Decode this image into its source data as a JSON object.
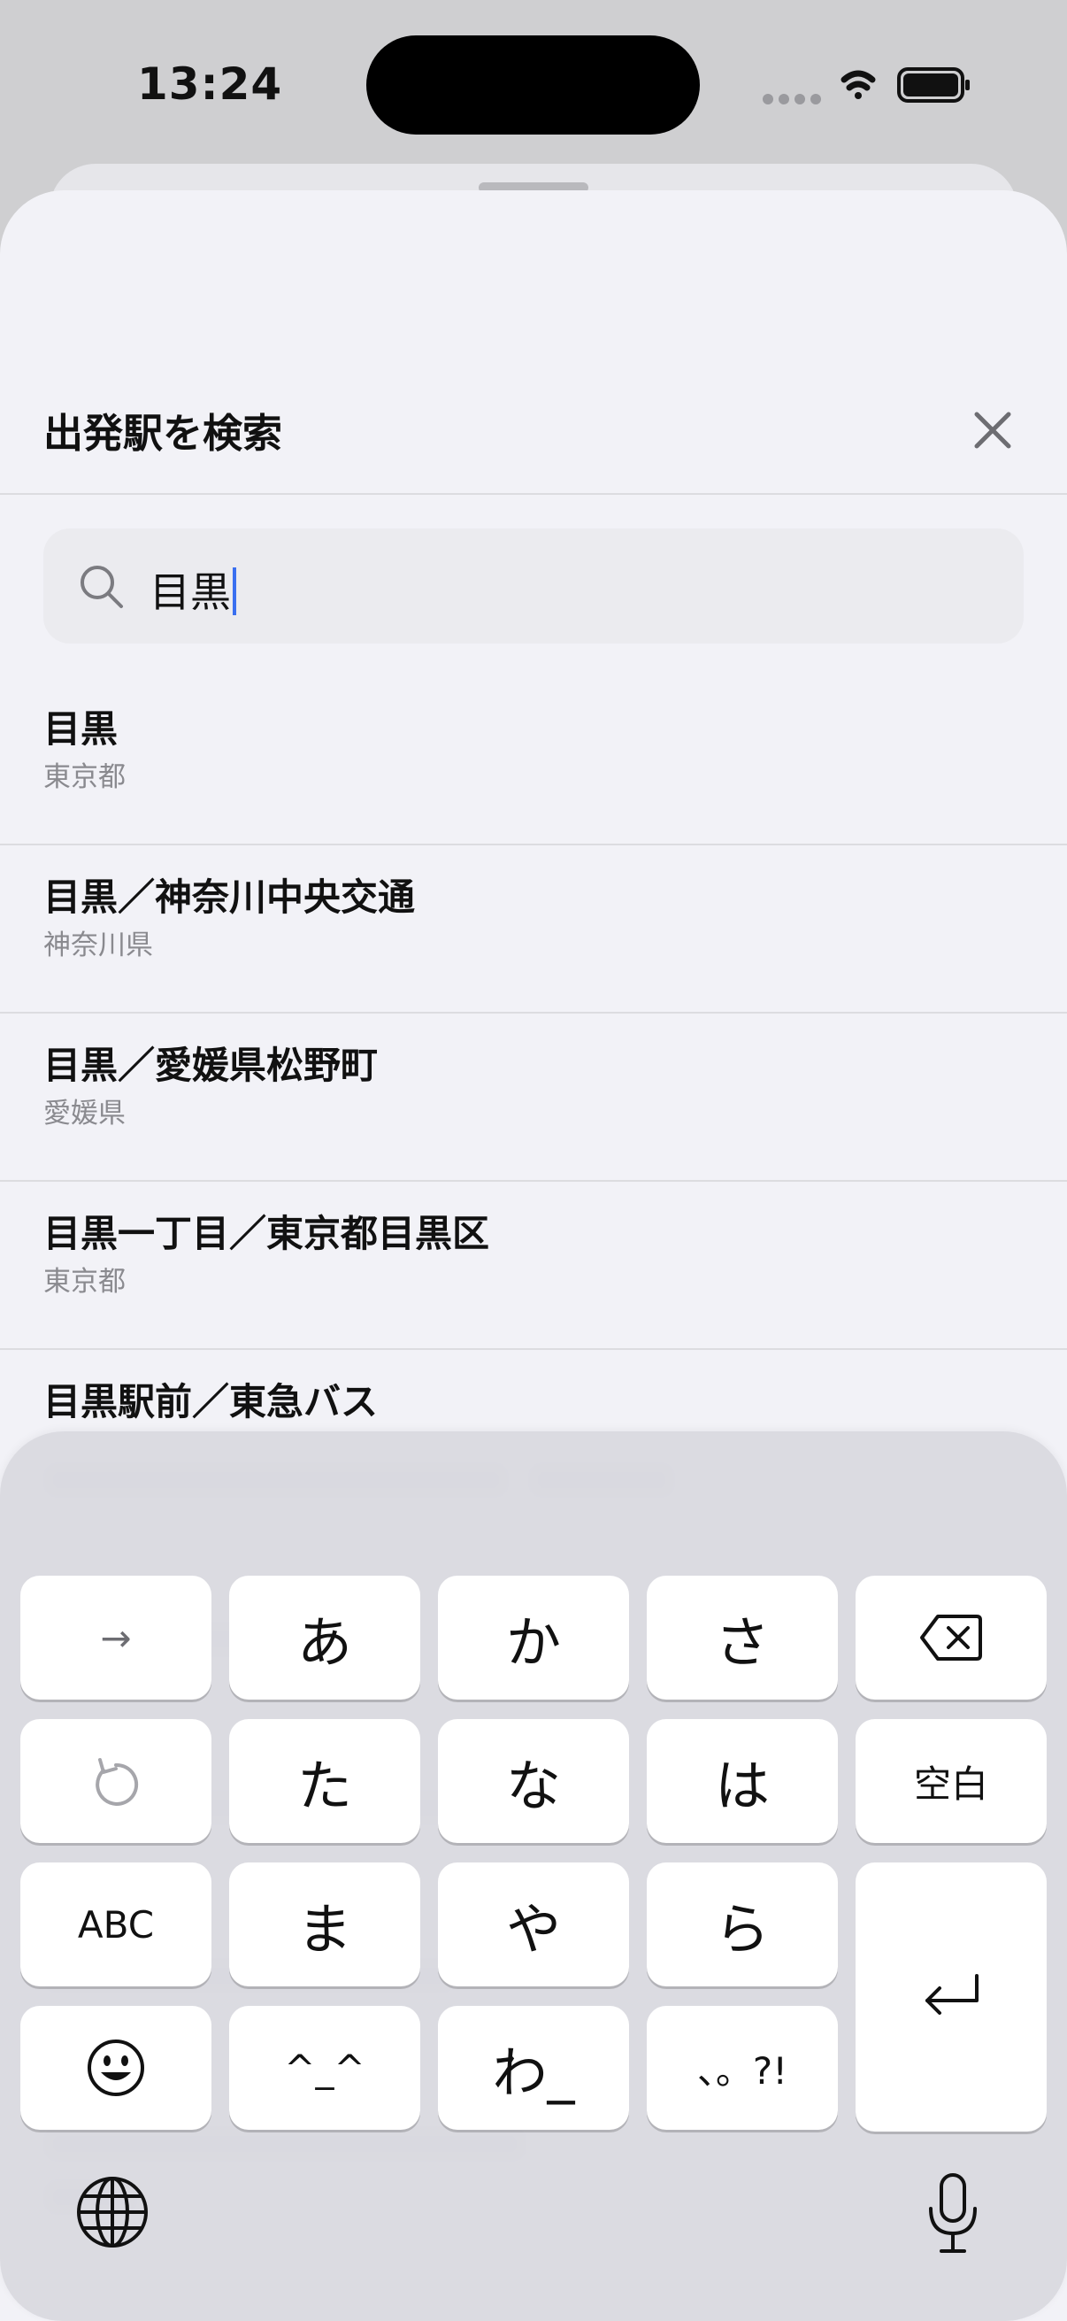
{
  "status_bar": {
    "time": "13:24"
  },
  "sheet": {
    "title": "出発駅を検索"
  },
  "search": {
    "value": "目黒"
  },
  "results": [
    {
      "name": "目黒",
      "prefecture": "東京都"
    },
    {
      "name": "目黒／神奈川中央交通",
      "prefecture": "神奈川県"
    },
    {
      "name": "目黒／愛媛県松野町",
      "prefecture": "愛媛県"
    },
    {
      "name": "目黒一丁目／東京都目黒区",
      "prefecture": "東京都"
    },
    {
      "name": "目黒駅前／東急バス",
      "prefecture": ""
    }
  ],
  "keyboard": {
    "row1": [
      "→",
      "あ",
      "か",
      "さ"
    ],
    "row2": [
      "",
      "た",
      "な",
      "は",
      "空白"
    ],
    "row3": [
      "ABC",
      "ま",
      "や",
      "ら"
    ],
    "row4": [
      "",
      "^_^",
      "わ_",
      "、。?!"
    ]
  },
  "colors": {
    "caret": "#3a6ff0",
    "sheet_bg": "#f2f2f7",
    "keyboard_bg": "#dadae0"
  }
}
